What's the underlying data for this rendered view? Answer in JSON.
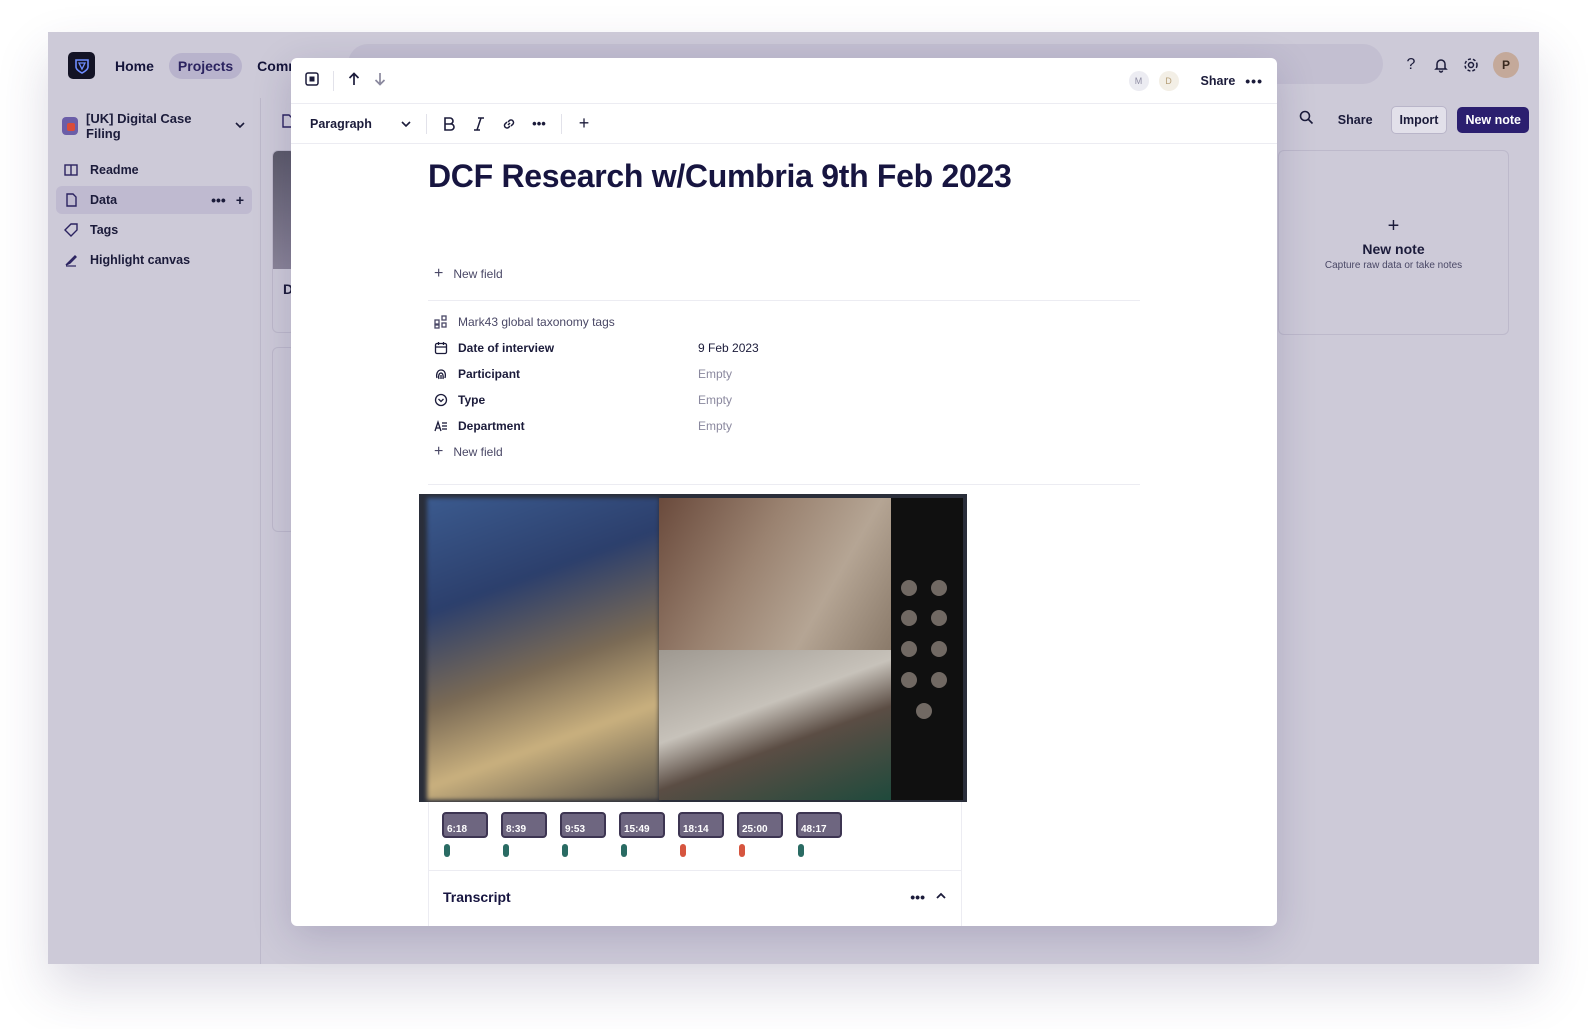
{
  "topbar": {
    "nav": [
      "Home",
      "Projects",
      "Commu"
    ],
    "avatar_initial": "P"
  },
  "sidebar": {
    "project_name": "[UK] Digital Case Filing",
    "items": [
      {
        "label": "Readme"
      },
      {
        "label": "Data"
      },
      {
        "label": "Tags"
      },
      {
        "label": "Highlight canvas"
      }
    ]
  },
  "background": {
    "share": "Share",
    "import": "Import",
    "new_note_button": "New note",
    "new_note_card_title": "New note",
    "new_note_card_sub": "Capture raw data or take notes",
    "card_letter": "D"
  },
  "modal": {
    "avatars": [
      "M",
      "D"
    ],
    "share": "Share",
    "toolbar": {
      "paragraph": "Paragraph"
    },
    "title": "DCF Research w/Cumbria 9th Feb 2023",
    "new_field": "New field",
    "fields": [
      {
        "name": "Mark43 global taxonomy tags",
        "value": ""
      },
      {
        "name": "Date of interview",
        "value": "9 Feb 2023"
      },
      {
        "name": "Participant",
        "value": "Empty"
      },
      {
        "name": "Type",
        "value": "Empty"
      },
      {
        "name": "Department",
        "value": "Empty"
      }
    ],
    "clips": [
      "6:18",
      "8:39",
      "9:53",
      "15:49",
      "18:14",
      "25:00",
      "48:17"
    ],
    "transcript": "Transcript"
  },
  "colors": {
    "primary": "#2b1f6f",
    "marker_green": "#2a6b63",
    "marker_red": "#d6553f"
  }
}
